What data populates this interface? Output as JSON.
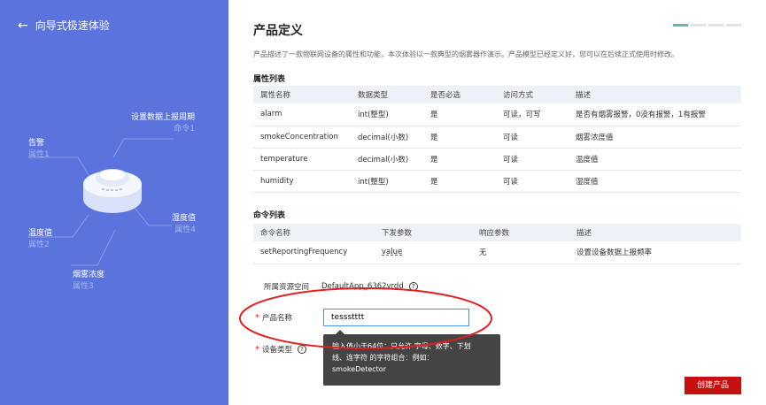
{
  "left": {
    "back_label": "向导式极速体验",
    "attributes": [
      {
        "name": "设置数据上报周期",
        "type": "命令1"
      },
      {
        "name": "告警",
        "type": "属性1"
      },
      {
        "name": "温度值",
        "type": "属性2"
      },
      {
        "name": "烟雾浓度",
        "type": "属性3"
      },
      {
        "name": "湿度值",
        "type": "属性4"
      }
    ]
  },
  "main": {
    "title": "产品定义",
    "description": "产品描述了一款物联网设备的属性和功能，本次体验以一款典型的烟雾器作演示。产品模型已经定义好，您可以在后续正式使用时修改。",
    "properties_title": "属性列表",
    "properties_headers": [
      "属性名称",
      "数据类型",
      "是否必选",
      "访问方式",
      "描述"
    ],
    "properties_rows": [
      [
        "alarm",
        "int(整型)",
        "是",
        "可读，可写",
        "是否有烟雾报警，0没有报警，1有报警"
      ],
      [
        "smokeConcentration",
        "decimal(小数)",
        "是",
        "可读",
        "烟雾浓度值"
      ],
      [
        "temperature",
        "decimal(小数)",
        "是",
        "可读",
        "温度值"
      ],
      [
        "humidity",
        "int(整型)",
        "是",
        "可读",
        "湿度值"
      ]
    ],
    "commands_title": "命令列表",
    "commands_headers": [
      "命令名称",
      "下发参数",
      "响应参数",
      "描述"
    ],
    "commands_rows": [
      [
        "setReportingFrequency",
        "value",
        "无",
        "设置设备数据上报频率"
      ]
    ],
    "resource_space_label": "所属资源空间",
    "resource_space_value": "DefaultApp_6362vrdd",
    "product_name_label": "产品名称",
    "product_name_value": "tessstttt",
    "device_type_label": "设备类型",
    "tooltip_lines": [
      "输入值小于64位：只允许 字母、数字、下划",
      "线、连字符 的字符组合：例如：",
      "smokeDetector"
    ],
    "create_button": "创建产品"
  },
  "colors": {
    "left_bg": "#5b73dd",
    "primary_button": "#c80f0f",
    "annotation_ellipse": "#e02020",
    "step_active": "#4ec0a8"
  }
}
